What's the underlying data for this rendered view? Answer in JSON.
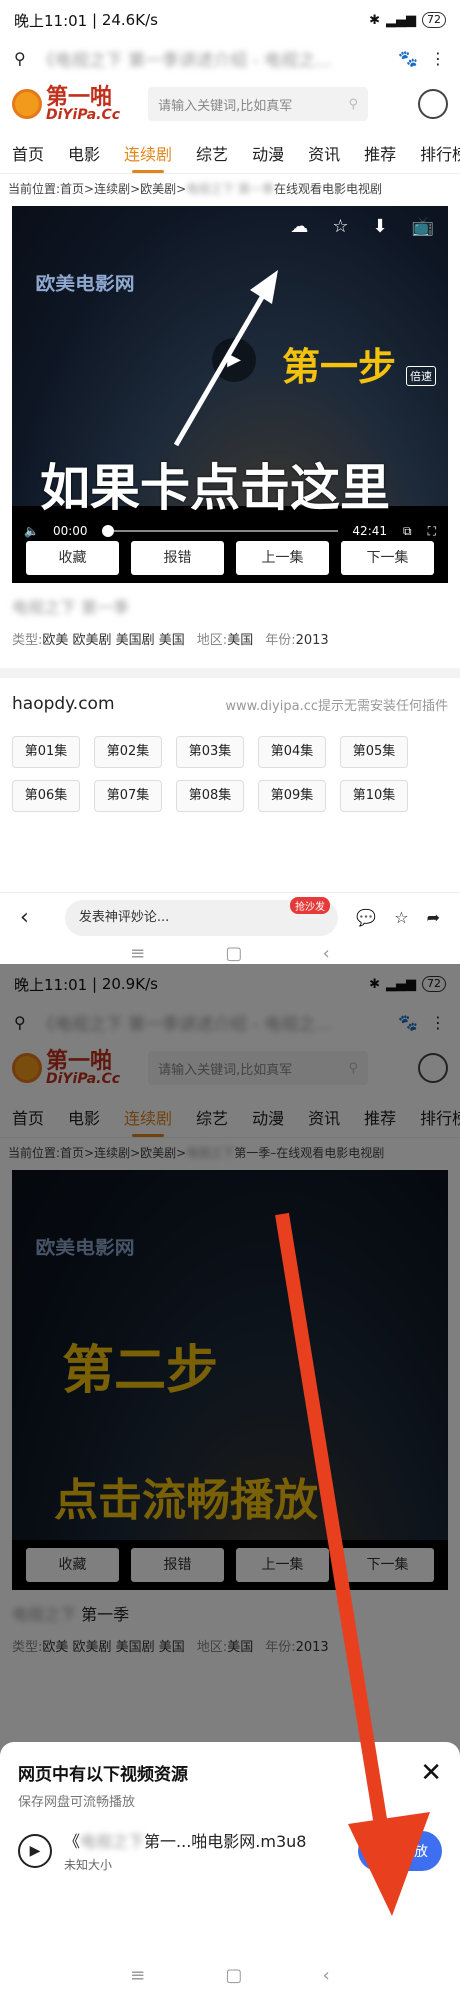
{
  "status1": {
    "time": "晚上11:01",
    "speed": "24.6K/s",
    "battery": "72"
  },
  "status2": {
    "time": "晚上11:01",
    "speed": "20.9K/s",
    "battery": "72"
  },
  "url1": "《电视之下 第一季讲述介绍 - 电视之...",
  "url2": "《电视之下 第一季讲述介绍 - 电视之...",
  "logo": {
    "cn": "第一啪",
    "en": "DiYiPa.Cc"
  },
  "search_placeholder": "请输入关键词,比如真军",
  "nav": [
    "首页",
    "电影",
    "连续剧",
    "综艺",
    "动漫",
    "资讯",
    "推荐",
    "排行榜"
  ],
  "crumb1": {
    "prefix": "当前位置:首页>连续剧>欧美剧>",
    "hidden": "电视之下 第一季",
    "suffix": "在线观看电影电视剧"
  },
  "crumb2": {
    "prefix": "当前位置:首页>连续剧>欧美剧>",
    "hidden": "电视之下",
    "suffix": "第一季–在线观看电影电视剧"
  },
  "video_title_text": "欧美电影网",
  "speed_label": "倍速",
  "time_current": "00:00",
  "time_total": "42:41",
  "buttons": [
    "收藏",
    "报错",
    "上一集",
    "下一集"
  ],
  "annotation1": {
    "step": "第一步",
    "hint": "如果卡点击这里"
  },
  "annotation2": {
    "step": "第二步",
    "hint": "点击流畅播放"
  },
  "title1": {
    "hidden": "电视之下 第一季",
    "show": ""
  },
  "title2": {
    "hidden": "电视之下",
    "show": "第一季"
  },
  "meta": {
    "type_label": "类型:",
    "type": "欧美 欧美剧 美国剧 美国",
    "area_label": "地区:",
    "area": "美国",
    "year_label": "年份:",
    "year": "2013"
  },
  "playlist": {
    "name": "haopdy.com",
    "hint": "www.diyipa.cc提示无需安装任何插件"
  },
  "episodes": [
    "第01集",
    "第02集",
    "第03集",
    "第04集",
    "第05集",
    "第06集",
    "第07集",
    "第08集",
    "第09集",
    "第10集"
  ],
  "comment_placeholder": "发表神评妙论...",
  "hot_badge": "抢沙发",
  "sheet": {
    "title": "网页中有以下视频资源",
    "subtitle": "保存网盘可流畅播放",
    "file_prefix": "《",
    "file_hidden": "电视之下",
    "file_name": "第一...啪电影网.m3u8",
    "size": "未知大小",
    "play": "流畅播放"
  }
}
